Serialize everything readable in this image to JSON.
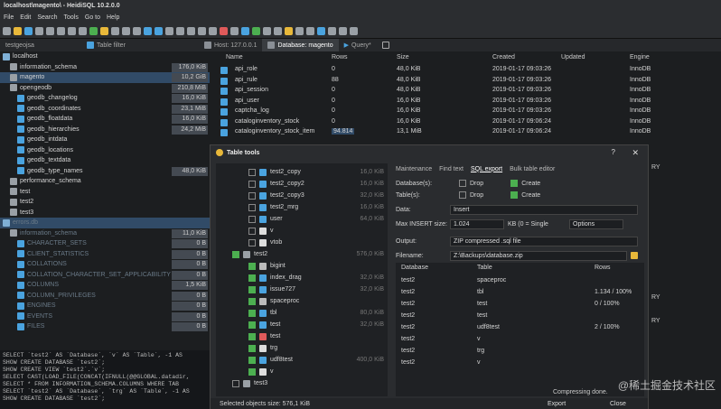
{
  "window": {
    "title": "localhost\\magento\\ - HeidiSQL 10.2.0.0"
  },
  "menu": [
    "File",
    "Edit",
    "Search",
    "Tools",
    "Go to",
    "Help"
  ],
  "tabs": {
    "db_filter": "testgeojsa",
    "table_filter": "Table filter",
    "host": "Host: 127.0.0.1",
    "database": "Database: magento",
    "query": "Query*"
  },
  "left_tree": [
    {
      "label": "localhost",
      "size": "",
      "icon": "server",
      "indent": 0
    },
    {
      "label": "information_schema",
      "size": "176,0 KiB",
      "icon": "db",
      "indent": 1
    },
    {
      "label": "magento",
      "size": "10,2 GiB",
      "icon": "db",
      "indent": 1
    },
    {
      "label": "opengeodb",
      "size": "210,8 MiB",
      "icon": "db",
      "indent": 1
    },
    {
      "label": "geodb_changelog",
      "size": "16,0 KiB",
      "icon": "table",
      "indent": 2
    },
    {
      "label": "geodb_coordinates",
      "size": "23,1 MiB",
      "icon": "table",
      "indent": 2
    },
    {
      "label": "geodb_floatdata",
      "size": "16,0 KiB",
      "icon": "table",
      "indent": 2
    },
    {
      "label": "geodb_hierarchies",
      "size": "24,2 MiB",
      "icon": "table",
      "indent": 2
    },
    {
      "label": "geodb_intdata",
      "size": "",
      "icon": "table",
      "indent": 2
    },
    {
      "label": "geodb_locations",
      "size": "",
      "icon": "table",
      "indent": 2
    },
    {
      "label": "geodb_textdata",
      "size": "",
      "icon": "table",
      "indent": 2
    },
    {
      "label": "geodb_type_names",
      "size": "48,0 KiB",
      "icon": "table",
      "indent": 2
    },
    {
      "label": "performance_schema",
      "size": "",
      "icon": "db",
      "indent": 1
    },
    {
      "label": "test",
      "size": "",
      "icon": "db",
      "indent": 1
    },
    {
      "label": "test2",
      "size": "",
      "icon": "db",
      "indent": 1
    },
    {
      "label": "test3",
      "size": "",
      "icon": "db",
      "indent": 1
    },
    {
      "label": "errors.db",
      "size": "",
      "icon": "server",
      "indent": 0
    },
    {
      "label": "information_schema",
      "size": "11,0 KiB",
      "icon": "db",
      "indent": 1
    },
    {
      "label": "CHARACTER_SETS",
      "size": "0 B",
      "icon": "table",
      "indent": 2
    },
    {
      "label": "CLIENT_STATISTICS",
      "size": "0 B",
      "icon": "table",
      "indent": 2
    },
    {
      "label": "COLLATIONS",
      "size": "0 B",
      "icon": "table",
      "indent": 2
    },
    {
      "label": "COLLATION_CHARACTER_SET_APPLICABILITY",
      "size": "0 B",
      "icon": "table",
      "indent": 2
    },
    {
      "label": "COLUMNS",
      "size": "1,5 KiB",
      "icon": "table",
      "indent": 2
    },
    {
      "label": "COLUMN_PRIVILEGES",
      "size": "0 B",
      "icon": "table",
      "indent": 2
    },
    {
      "label": "ENGINES",
      "size": "0 B",
      "icon": "table",
      "indent": 2
    },
    {
      "label": "EVENTS",
      "size": "0 B",
      "icon": "table",
      "indent": 2
    },
    {
      "label": "FILES",
      "size": "0 B",
      "icon": "table",
      "indent": 2
    }
  ],
  "grid": {
    "headers": [
      "Name",
      "Rows",
      "Size",
      "Created",
      "Updated",
      "Engine"
    ],
    "rows": [
      [
        "api_role",
        "0",
        "48,0 KiB",
        "2019-01-17 09:03:26",
        "",
        "InnoDB"
      ],
      [
        "api_rule",
        "88",
        "48,0 KiB",
        "2019-01-17 09:03:26",
        "",
        "InnoDB"
      ],
      [
        "api_session",
        "0",
        "48,0 KiB",
        "2019-01-17 09:03:26",
        "",
        "InnoDB"
      ],
      [
        "api_user",
        "0",
        "16,0 KiB",
        "2019-01-17 09:03:26",
        "",
        "InnoDB"
      ],
      [
        "captcha_log",
        "0",
        "16,0 KiB",
        "2019-01-17 09:03:26",
        "",
        "InnoDB"
      ],
      [
        "cataloginventory_stock",
        "0",
        "16,0 KiB",
        "2019-01-17 09:06:24",
        "",
        "InnoDB"
      ],
      [
        "cataloginventory_stock_item",
        "94.814",
        "13,1 MiB",
        "2019-01-17 09:06:24",
        "",
        "InnoDB"
      ]
    ],
    "engine_tail": [
      "RY",
      "RY",
      "RY"
    ]
  },
  "sql_log": [
    "SELECT `test2` AS `Database`, `v` AS `Table`, -1 AS",
    "SHOW CREATE DATABASE `test2`;",
    "SHOW CREATE VIEW `test2`.`v`;",
    "SELECT CAST(LOAD_FILE(CONCAT(IFNULL(@@GLOBAL.datadir,",
    "SELECT * FROM INFORMATION_SCHEMA.COLUMNS WHERE   TAB",
    "SELECT `test2` AS `Database`, `trg` AS `Table`, -1 AS",
    "SHOW CREATE DATABASE `test2`;"
  ],
  "dialog": {
    "title": "Table tools",
    "help": "?",
    "close": "✕",
    "tabs": [
      "Maintenance",
      "Find text",
      "SQL export",
      "Bulk table editor"
    ],
    "active_tab": "SQL export",
    "tree": [
      {
        "label": "test2_copy",
        "size": "16,0 KiB",
        "checked": false,
        "indent": 2,
        "icon": "table"
      },
      {
        "label": "test2_copy2",
        "size": "16,0 KiB",
        "checked": false,
        "indent": 2,
        "icon": "table"
      },
      {
        "label": "test2_copy3",
        "size": "32,0 KiB",
        "checked": false,
        "indent": 2,
        "icon": "table"
      },
      {
        "label": "test2_mrg",
        "size": "16,0 KiB",
        "checked": false,
        "indent": 2,
        "icon": "table"
      },
      {
        "label": "user",
        "size": "64,0 KiB",
        "checked": false,
        "indent": 2,
        "icon": "table"
      },
      {
        "label": "v",
        "size": "",
        "checked": false,
        "indent": 2,
        "icon": "view"
      },
      {
        "label": "vtob",
        "size": "",
        "checked": false,
        "indent": 2,
        "icon": "view"
      },
      {
        "label": "test2",
        "size": "576,0 KiB",
        "checked": true,
        "indent": 1,
        "icon": "db"
      },
      {
        "label": "bigint",
        "size": "",
        "checked": true,
        "indent": 2,
        "icon": "proc"
      },
      {
        "label": "index_drag",
        "size": "32,0 KiB",
        "checked": true,
        "indent": 2,
        "icon": "table"
      },
      {
        "label": "issue727",
        "size": "32,0 KiB",
        "checked": true,
        "indent": 2,
        "icon": "table"
      },
      {
        "label": "spaceproc",
        "size": "",
        "checked": true,
        "indent": 2,
        "icon": "proc"
      },
      {
        "label": "tbl",
        "size": "80,0 KiB",
        "checked": true,
        "indent": 2,
        "icon": "table"
      },
      {
        "label": "test",
        "size": "32,0 KiB",
        "checked": true,
        "indent": 2,
        "icon": "table"
      },
      {
        "label": "test",
        "size": "",
        "checked": true,
        "indent": 2,
        "icon": "event"
      },
      {
        "label": "trg",
        "size": "",
        "checked": true,
        "indent": 2,
        "icon": "trigger"
      },
      {
        "label": "udf8test",
        "size": "400,0 KiB",
        "checked": true,
        "indent": 2,
        "icon": "table"
      },
      {
        "label": "v",
        "size": "",
        "checked": true,
        "indent": 2,
        "icon": "view"
      },
      {
        "label": "test3",
        "size": "",
        "checked": false,
        "indent": 1,
        "icon": "db"
      }
    ],
    "options": {
      "database_label": "Database(s):",
      "tables_label": "Table(s):",
      "drop": "Drop",
      "create": "Create",
      "data_label": "Data:",
      "data_value": "Insert",
      "max_insert_label": "Max INSERT size:",
      "max_insert_value": "1.024",
      "max_insert_unit": "KB (0 = Single",
      "options_btn": "Options",
      "output_label": "Output:",
      "output_value": "ZIP compressed .sql file",
      "filename_label": "Filename:",
      "filename_value": "Z:\\Backups\\database.zip"
    },
    "result_headers": [
      "Database",
      "Table",
      "Rows"
    ],
    "results": [
      [
        "test2",
        "spaceproc",
        ""
      ],
      [
        "test2",
        "tbl",
        "1.134 / 100%"
      ],
      [
        "test2",
        "test",
        "0 / 100%"
      ],
      [
        "test2",
        "test",
        ""
      ],
      [
        "test2",
        "udf8test",
        "2 / 100%"
      ],
      [
        "test2",
        "v",
        ""
      ],
      [
        "test2",
        "trg",
        ""
      ],
      [
        "test2",
        "v",
        ""
      ]
    ],
    "status": "Selected objects size: 576,1 KiB",
    "progress_text": "Compressing done.",
    "export_btn": "Export",
    "close_btn": "Close"
  },
  "watermark": "@稀土掘金技术社区"
}
